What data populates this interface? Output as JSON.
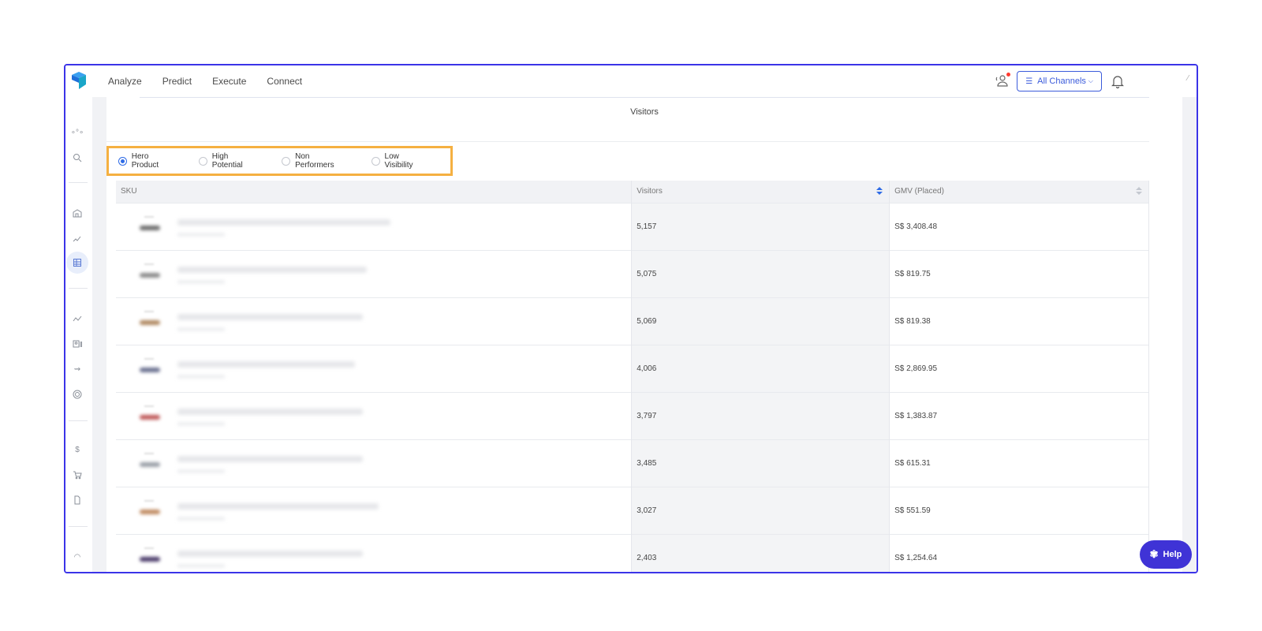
{
  "nav": {
    "items": [
      "Analyze",
      "Predict",
      "Execute",
      "Connect"
    ]
  },
  "header": {
    "channel_label": "All Channels"
  },
  "section": {
    "title": "Visitors"
  },
  "filters": {
    "options": [
      "Hero Product",
      "High Potential",
      "Non Performers",
      "Low Visibility"
    ],
    "selected": "Hero Product"
  },
  "table": {
    "headers": {
      "sku": "SKU",
      "visitors": "Visitors",
      "gmv": "GMV (Placed)"
    },
    "rows": [
      {
        "visitors": "5,157",
        "gmv": "S$ 3,408.48"
      },
      {
        "visitors": "5,075",
        "gmv": "S$ 819.75"
      },
      {
        "visitors": "5,069",
        "gmv": "S$ 819.38"
      },
      {
        "visitors": "4,006",
        "gmv": "S$ 2,869.95"
      },
      {
        "visitors": "3,797",
        "gmv": "S$ 1,383.87"
      },
      {
        "visitors": "3,485",
        "gmv": "S$ 615.31"
      },
      {
        "visitors": "3,027",
        "gmv": "S$ 551.59"
      },
      {
        "visitors": "2,403",
        "gmv": "S$ 1,254.64"
      }
    ]
  },
  "help": {
    "label": "Help"
  },
  "colors": {
    "accent": "#3b34e8",
    "highlight": "#f5b041",
    "radio_active": "#2e6be6",
    "help_bg": "#3f33d6"
  }
}
